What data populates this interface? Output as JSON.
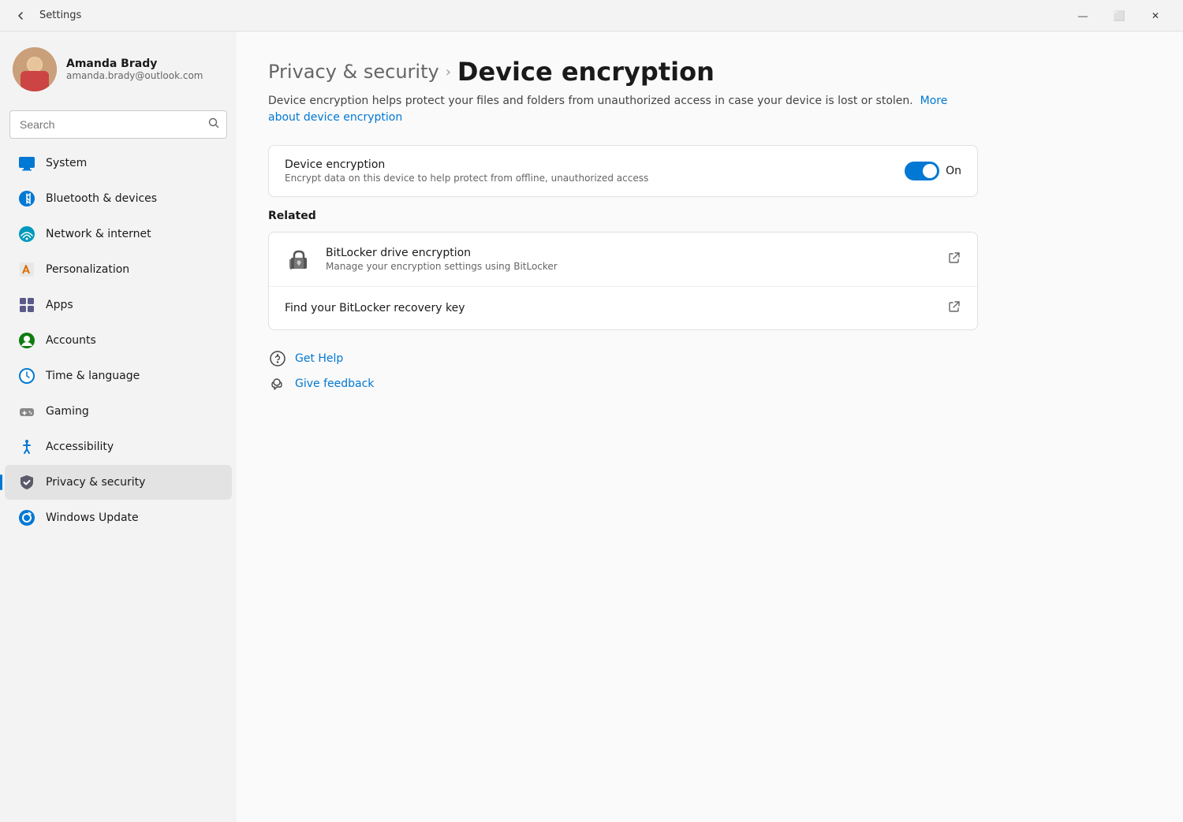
{
  "titlebar": {
    "title": "Settings",
    "back_label": "←",
    "minimize": "—",
    "restore": "⬜",
    "close": "✕"
  },
  "sidebar": {
    "user": {
      "name": "Amanda Brady",
      "email": "amanda.brady@outlook.com"
    },
    "search": {
      "placeholder": "Search",
      "icon": "🔍"
    },
    "nav_items": [
      {
        "id": "system",
        "label": "System",
        "icon": "💻",
        "active": false
      },
      {
        "id": "bluetooth",
        "label": "Bluetooth & devices",
        "icon": "🔵",
        "active": false
      },
      {
        "id": "network",
        "label": "Network & internet",
        "icon": "📶",
        "active": false
      },
      {
        "id": "personalization",
        "label": "Personalization",
        "icon": "✏️",
        "active": false
      },
      {
        "id": "apps",
        "label": "Apps",
        "icon": "📦",
        "active": false
      },
      {
        "id": "accounts",
        "label": "Accounts",
        "icon": "👤",
        "active": false
      },
      {
        "id": "time",
        "label": "Time & language",
        "icon": "🌐",
        "active": false
      },
      {
        "id": "gaming",
        "label": "Gaming",
        "icon": "🎮",
        "active": false
      },
      {
        "id": "accessibility",
        "label": "Accessibility",
        "icon": "♿",
        "active": false
      },
      {
        "id": "privacy",
        "label": "Privacy & security",
        "icon": "🛡️",
        "active": true
      },
      {
        "id": "update",
        "label": "Windows Update",
        "icon": "🔄",
        "active": false
      }
    ]
  },
  "content": {
    "breadcrumb_parent": "Privacy & security",
    "breadcrumb_sep": "›",
    "page_title": "Device encryption",
    "description": "Device encryption helps protect your files and folders from unauthorized access in case your device is lost or stolen.",
    "description_link": "More about device encryption",
    "main_setting": {
      "title": "Device encryption",
      "description": "Encrypt data on this device to help protect from offline, unauthorized access",
      "toggle_state": "on",
      "toggle_label": "On"
    },
    "related_title": "Related",
    "related_items": [
      {
        "id": "bitlocker",
        "title": "BitLocker drive encryption",
        "description": "Manage your encryption settings using BitLocker",
        "has_external": true
      },
      {
        "id": "recovery-key",
        "title": "Find your BitLocker recovery key",
        "description": "",
        "has_external": true
      }
    ],
    "help_links": [
      {
        "id": "get-help",
        "label": "Get Help",
        "icon": "help"
      },
      {
        "id": "give-feedback",
        "label": "Give feedback",
        "icon": "feedback"
      }
    ]
  }
}
